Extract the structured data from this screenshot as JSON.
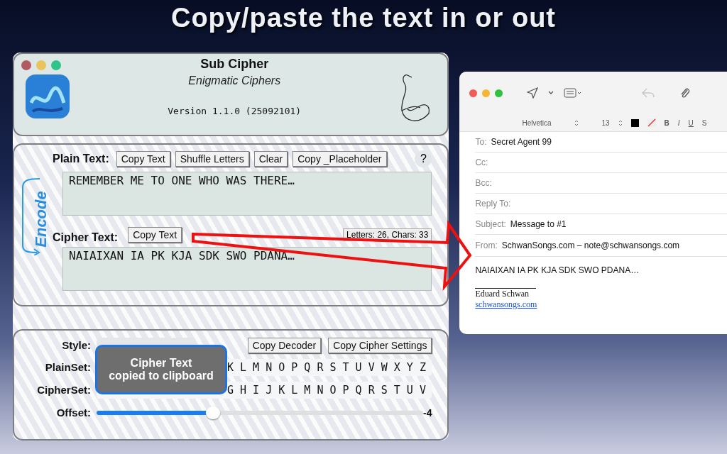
{
  "banner": {
    "title": "Copy/paste the text in or out"
  },
  "cipher_window": {
    "title": "Sub Cipher",
    "subtitle": "Enigmatic Ciphers",
    "version": "Version 1.1.0 (25092101)",
    "plain_text": {
      "label": "Plain Text:",
      "buttons": [
        "Copy Text",
        "Shuffle Letters",
        "Clear",
        "Copy _Placeholder"
      ],
      "help": "?",
      "value": "REMEMBER ME TO ONE WHO WAS THERE…"
    },
    "encode_label": "Encode",
    "cipher_text": {
      "label": "Cipher Text:",
      "button": "Copy Text",
      "counts": "Letters: 26, Chars: 33",
      "value": "NAIAIXAN IA PK KJA SDK SWO PDANA…"
    },
    "settings": {
      "style_label": "Style:",
      "buttons": [
        "Copy Decoder",
        "Copy Cipher Settings"
      ],
      "plainset_label": "PlainSet:",
      "plainset": "K L M N O P Q R S T U V W X Y Z",
      "cipherset_label": "CipherSet:",
      "cipherset": "G H I J K L M N O P Q R S T U V",
      "offset_label": "Offset:",
      "offset": {
        "level": 0.35
      },
      "offset_reading": "-4"
    },
    "toast": {
      "lines": [
        "Cipher Text",
        "copied to clipboard"
      ]
    }
  },
  "mail_window": {
    "font": "Helvetica",
    "size": "13",
    "format_buttons": [
      "B",
      "I",
      "U",
      "S"
    ],
    "fields": [
      {
        "label": "To:",
        "value": "Secret Agent 99"
      },
      {
        "label": "Cc:"
      },
      {
        "label": "Bcc:"
      },
      {
        "label": "Reply To:"
      },
      {
        "label": "Subject:",
        "value": "Message to #1"
      },
      {
        "label": "From:",
        "value": "SchwanSongs.com – note@schwansongs.com"
      }
    ],
    "body": "NAIAIXAN IA PK KJA SDK SWO PDANA…",
    "signature_name": "Eduard Schwan",
    "signature_link": "schwansongs.com"
  }
}
